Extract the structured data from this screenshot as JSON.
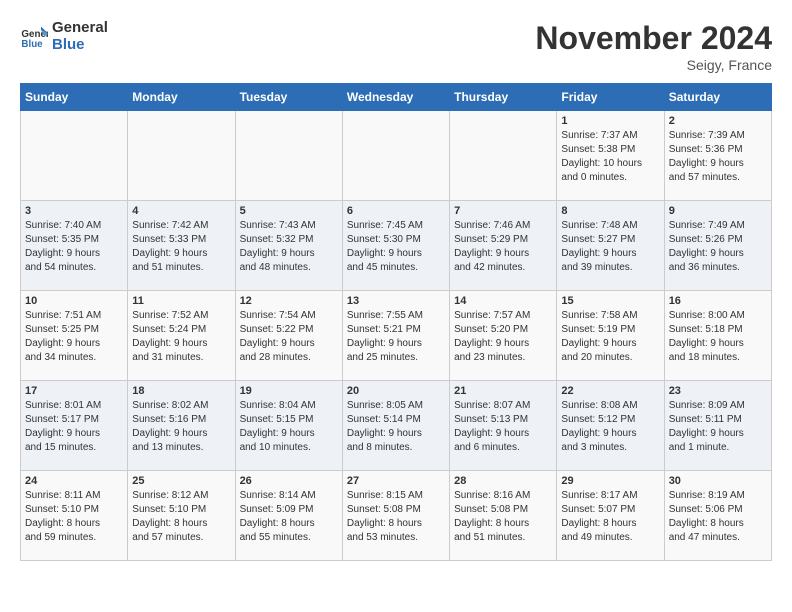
{
  "header": {
    "logo_line1": "General",
    "logo_line2": "Blue",
    "month_title": "November 2024",
    "subtitle": "Seigy, France"
  },
  "weekdays": [
    "Sunday",
    "Monday",
    "Tuesday",
    "Wednesday",
    "Thursday",
    "Friday",
    "Saturday"
  ],
  "weeks": [
    [
      {
        "day": "",
        "info": ""
      },
      {
        "day": "",
        "info": ""
      },
      {
        "day": "",
        "info": ""
      },
      {
        "day": "",
        "info": ""
      },
      {
        "day": "",
        "info": ""
      },
      {
        "day": "1",
        "info": "Sunrise: 7:37 AM\nSunset: 5:38 PM\nDaylight: 10 hours\nand 0 minutes."
      },
      {
        "day": "2",
        "info": "Sunrise: 7:39 AM\nSunset: 5:36 PM\nDaylight: 9 hours\nand 57 minutes."
      }
    ],
    [
      {
        "day": "3",
        "info": "Sunrise: 7:40 AM\nSunset: 5:35 PM\nDaylight: 9 hours\nand 54 minutes."
      },
      {
        "day": "4",
        "info": "Sunrise: 7:42 AM\nSunset: 5:33 PM\nDaylight: 9 hours\nand 51 minutes."
      },
      {
        "day": "5",
        "info": "Sunrise: 7:43 AM\nSunset: 5:32 PM\nDaylight: 9 hours\nand 48 minutes."
      },
      {
        "day": "6",
        "info": "Sunrise: 7:45 AM\nSunset: 5:30 PM\nDaylight: 9 hours\nand 45 minutes."
      },
      {
        "day": "7",
        "info": "Sunrise: 7:46 AM\nSunset: 5:29 PM\nDaylight: 9 hours\nand 42 minutes."
      },
      {
        "day": "8",
        "info": "Sunrise: 7:48 AM\nSunset: 5:27 PM\nDaylight: 9 hours\nand 39 minutes."
      },
      {
        "day": "9",
        "info": "Sunrise: 7:49 AM\nSunset: 5:26 PM\nDaylight: 9 hours\nand 36 minutes."
      }
    ],
    [
      {
        "day": "10",
        "info": "Sunrise: 7:51 AM\nSunset: 5:25 PM\nDaylight: 9 hours\nand 34 minutes."
      },
      {
        "day": "11",
        "info": "Sunrise: 7:52 AM\nSunset: 5:24 PM\nDaylight: 9 hours\nand 31 minutes."
      },
      {
        "day": "12",
        "info": "Sunrise: 7:54 AM\nSunset: 5:22 PM\nDaylight: 9 hours\nand 28 minutes."
      },
      {
        "day": "13",
        "info": "Sunrise: 7:55 AM\nSunset: 5:21 PM\nDaylight: 9 hours\nand 25 minutes."
      },
      {
        "day": "14",
        "info": "Sunrise: 7:57 AM\nSunset: 5:20 PM\nDaylight: 9 hours\nand 23 minutes."
      },
      {
        "day": "15",
        "info": "Sunrise: 7:58 AM\nSunset: 5:19 PM\nDaylight: 9 hours\nand 20 minutes."
      },
      {
        "day": "16",
        "info": "Sunrise: 8:00 AM\nSunset: 5:18 PM\nDaylight: 9 hours\nand 18 minutes."
      }
    ],
    [
      {
        "day": "17",
        "info": "Sunrise: 8:01 AM\nSunset: 5:17 PM\nDaylight: 9 hours\nand 15 minutes."
      },
      {
        "day": "18",
        "info": "Sunrise: 8:02 AM\nSunset: 5:16 PM\nDaylight: 9 hours\nand 13 minutes."
      },
      {
        "day": "19",
        "info": "Sunrise: 8:04 AM\nSunset: 5:15 PM\nDaylight: 9 hours\nand 10 minutes."
      },
      {
        "day": "20",
        "info": "Sunrise: 8:05 AM\nSunset: 5:14 PM\nDaylight: 9 hours\nand 8 minutes."
      },
      {
        "day": "21",
        "info": "Sunrise: 8:07 AM\nSunset: 5:13 PM\nDaylight: 9 hours\nand 6 minutes."
      },
      {
        "day": "22",
        "info": "Sunrise: 8:08 AM\nSunset: 5:12 PM\nDaylight: 9 hours\nand 3 minutes."
      },
      {
        "day": "23",
        "info": "Sunrise: 8:09 AM\nSunset: 5:11 PM\nDaylight: 9 hours\nand 1 minute."
      }
    ],
    [
      {
        "day": "24",
        "info": "Sunrise: 8:11 AM\nSunset: 5:10 PM\nDaylight: 8 hours\nand 59 minutes."
      },
      {
        "day": "25",
        "info": "Sunrise: 8:12 AM\nSunset: 5:10 PM\nDaylight: 8 hours\nand 57 minutes."
      },
      {
        "day": "26",
        "info": "Sunrise: 8:14 AM\nSunset: 5:09 PM\nDaylight: 8 hours\nand 55 minutes."
      },
      {
        "day": "27",
        "info": "Sunrise: 8:15 AM\nSunset: 5:08 PM\nDaylight: 8 hours\nand 53 minutes."
      },
      {
        "day": "28",
        "info": "Sunrise: 8:16 AM\nSunset: 5:08 PM\nDaylight: 8 hours\nand 51 minutes."
      },
      {
        "day": "29",
        "info": "Sunrise: 8:17 AM\nSunset: 5:07 PM\nDaylight: 8 hours\nand 49 minutes."
      },
      {
        "day": "30",
        "info": "Sunrise: 8:19 AM\nSunset: 5:06 PM\nDaylight: 8 hours\nand 47 minutes."
      }
    ]
  ]
}
